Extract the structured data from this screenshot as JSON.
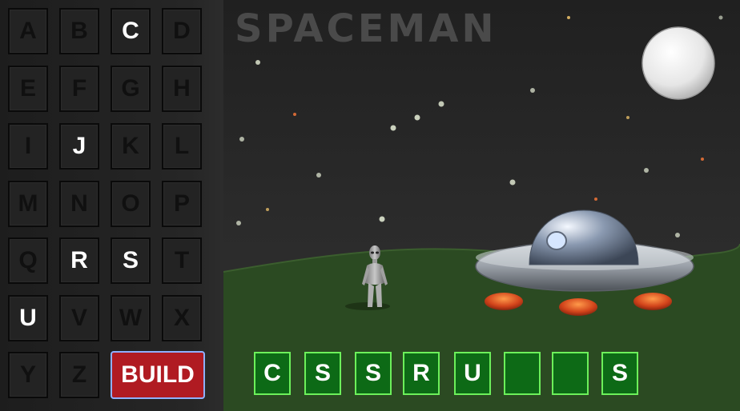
{
  "title": "SPACEMAN",
  "keyboard": {
    "keys": [
      {
        "letter": "A",
        "used": false
      },
      {
        "letter": "B",
        "used": false
      },
      {
        "letter": "C",
        "used": true
      },
      {
        "letter": "D",
        "used": false
      },
      {
        "letter": "E",
        "used": false
      },
      {
        "letter": "F",
        "used": false
      },
      {
        "letter": "G",
        "used": false
      },
      {
        "letter": "H",
        "used": false
      },
      {
        "letter": "I",
        "used": false
      },
      {
        "letter": "J",
        "used": true
      },
      {
        "letter": "K",
        "used": false
      },
      {
        "letter": "L",
        "used": false
      },
      {
        "letter": "M",
        "used": false
      },
      {
        "letter": "N",
        "used": false
      },
      {
        "letter": "O",
        "used": false
      },
      {
        "letter": "P",
        "used": false
      },
      {
        "letter": "Q",
        "used": false
      },
      {
        "letter": "R",
        "used": true
      },
      {
        "letter": "S",
        "used": true
      },
      {
        "letter": "T",
        "used": false
      },
      {
        "letter": "U",
        "used": true
      },
      {
        "letter": "V",
        "used": false
      },
      {
        "letter": "W",
        "used": false
      },
      {
        "letter": "X",
        "used": false
      },
      {
        "letter": "Y",
        "used": false
      },
      {
        "letter": "Z",
        "used": false
      }
    ],
    "build_label": "BUILD"
  },
  "word": {
    "slots": [
      "C",
      "S",
      "S",
      "R",
      "U",
      "",
      "",
      "S"
    ]
  },
  "colors": {
    "build": "#b01b22",
    "slot_fill": "#0d6a16",
    "slot_border": "#6cf05a",
    "grass": "#2b4a22"
  }
}
